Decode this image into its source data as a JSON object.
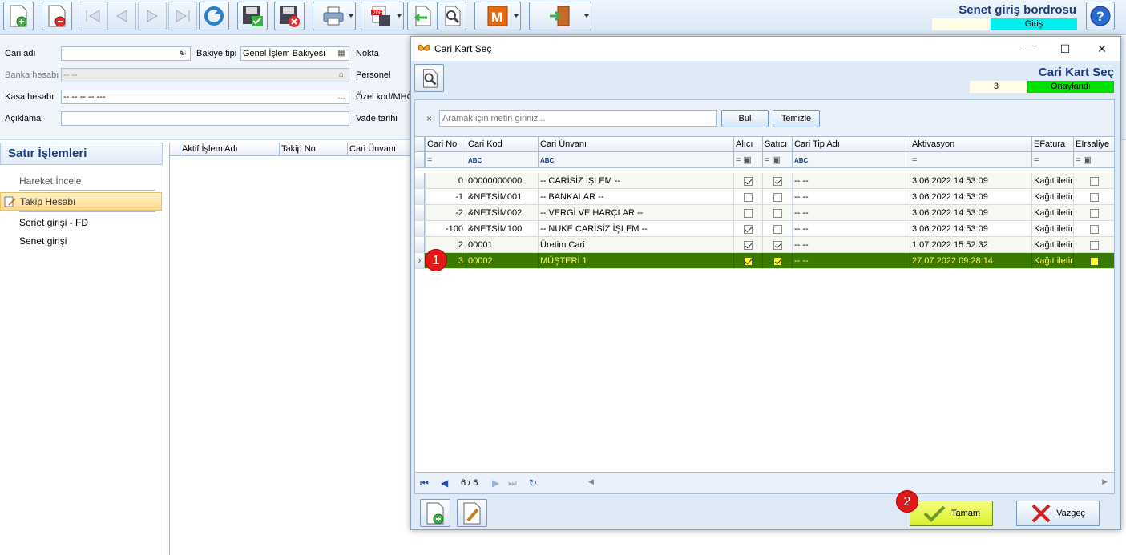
{
  "app": {
    "title": "Senet giriş bordrosu",
    "status": "Giriş"
  },
  "form": {
    "cari_adi_label": "Cari adı",
    "bakiye_tipi_label": "Bakiye tipi",
    "bakiye_tipi_value": "Genel İşlem Bakiyesi",
    "nokta_label": "Nokta",
    "banka_label": "Banka hesabı",
    "banka_value": "-- --",
    "personel_label": "Personel",
    "kasa_label": "Kasa hesabı",
    "kasa_value": "-- -- -- -- ---",
    "ozel_kod_label": "Özel kod/MHÖ",
    "aciklama_label": "Açıklama",
    "vade_label": "Vade tarihi"
  },
  "left_panel": {
    "title": "Satır İşlemleri",
    "items": [
      "Hareket İncele",
      "Takip Hesabı",
      "Senet girişi - FD",
      "Senet girişi"
    ]
  },
  "main_grid": {
    "columns": [
      "Aktif İşlem Adı",
      "Takip No",
      "Cari Ünvanı"
    ]
  },
  "dialog": {
    "title": "Cari Kart Seç",
    "header_title": "Cari Kart Seç",
    "count": "3",
    "status": "Onaylandı",
    "search_placeholder": "Aramak için metin giriniz...",
    "search_clear": "×",
    "find_label": "Bul",
    "clear_label": "Temizle",
    "columns": [
      "Cari No",
      "Cari Kod",
      "Cari Ünvanı",
      "Alıcı",
      "Satıcı",
      "Cari Tip Adı",
      "Aktivasyon",
      "EFatura",
      "EIrsaliye"
    ],
    "rows": [
      {
        "no": "0",
        "kod": "00000000000",
        "unvan": "-- CARİSİZ İŞLEM --",
        "alici": true,
        "satici": true,
        "tip": "-- --",
        "aktivasyon": "3.06.2022 14:53:09",
        "efatura": "Kağıt iletin",
        "eirsaliye": false
      },
      {
        "no": "-1",
        "kod": "&NETSİM001",
        "unvan": "-- BANKALAR --",
        "alici": false,
        "satici": false,
        "tip": "-- --",
        "aktivasyon": "3.06.2022 14:53:09",
        "efatura": "Kağıt iletin",
        "eirsaliye": false
      },
      {
        "no": "-2",
        "kod": "&NETSİM002",
        "unvan": "-- VERGİ VE HARÇLAR --",
        "alici": false,
        "satici": false,
        "tip": "-- --",
        "aktivasyon": "3.06.2022 14:53:09",
        "efatura": "Kağıt iletin",
        "eirsaliye": false
      },
      {
        "no": "-100",
        "kod": "&NETSİM100",
        "unvan": "-- NUKE CARİSİZ İŞLEM --",
        "alici": true,
        "satici": false,
        "tip": "-- --",
        "aktivasyon": "3.06.2022 14:53:09",
        "efatura": "Kağıt iletin",
        "eirsaliye": false
      },
      {
        "no": "2",
        "kod": "00001",
        "unvan": "Üretim Cari",
        "alici": true,
        "satici": true,
        "tip": "-- --",
        "aktivasyon": "1.07.2022 15:52:32",
        "efatura": "Kağıt iletin",
        "eirsaliye": false
      },
      {
        "no": "3",
        "kod": "00002",
        "unvan": "MÜŞTERİ 1",
        "alici": true,
        "satici": true,
        "tip": "-- --",
        "aktivasyon": "27.07.2022 09:28:14",
        "efatura": "Kağıt iletin",
        "eirsaliye": false
      }
    ],
    "selected_row": 5,
    "navigator_page": "6 / 6",
    "ok_label": "Tamam",
    "cancel_label": "Vazgeç"
  },
  "badges": [
    "1",
    "2"
  ],
  "colors": {
    "title_blue": "#1a3a80",
    "status_cyan": "#00f0f0",
    "status_green": "#00e000",
    "selected_row": "#3a7a00",
    "ok_button": "#d9ef2a"
  }
}
